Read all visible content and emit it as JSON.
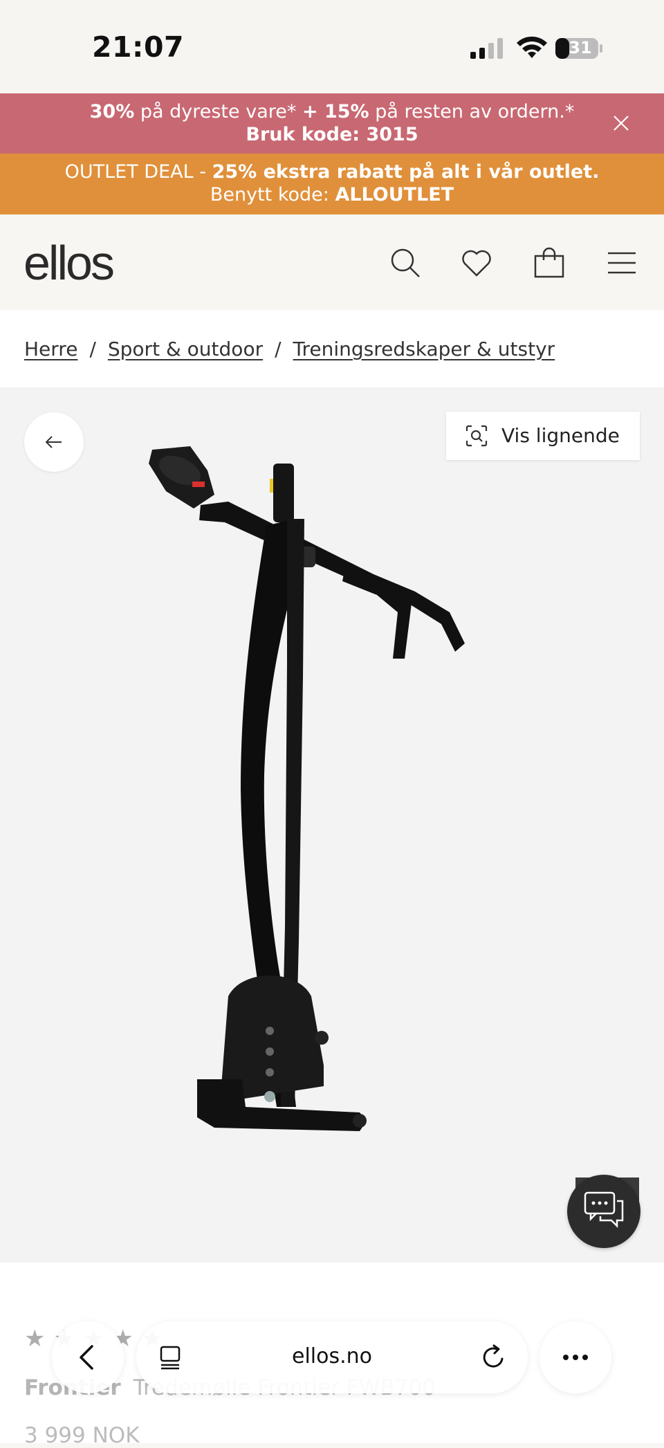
{
  "status_bar": {
    "time": "21:07",
    "battery": "31"
  },
  "promo_1": {
    "bold_1": "30%",
    "text_1": " på dyreste vare* ",
    "bold_2": "+ 15%",
    "text_2": " på resten av ordern.* ",
    "bold_3": "Bruk kode: 3015"
  },
  "promo_2": {
    "text_1": "OUTLET DEAL - ",
    "bold_1": "25% ekstra rabatt på alt i vår outlet.",
    "text_2": "Benytt kode: ",
    "bold_2": "ALLOUTLET"
  },
  "header": {
    "logo": "ellos"
  },
  "breadcrumb": [
    "Herre",
    "Sport & outdoor",
    "Treningsredskaper & utstyr"
  ],
  "breadcrumb_separator": "/",
  "gallery": {
    "similar_label": "Vis lignende"
  },
  "product": {
    "stars": "★★★★★",
    "brand": "Frontier",
    "name": "Tredemølle Frontier FWB700",
    "price": "3 999 NOK"
  },
  "browser": {
    "url": "ellos.no"
  },
  "colors": {
    "promo_pink": "#c86872",
    "promo_orange": "#e0903a"
  }
}
